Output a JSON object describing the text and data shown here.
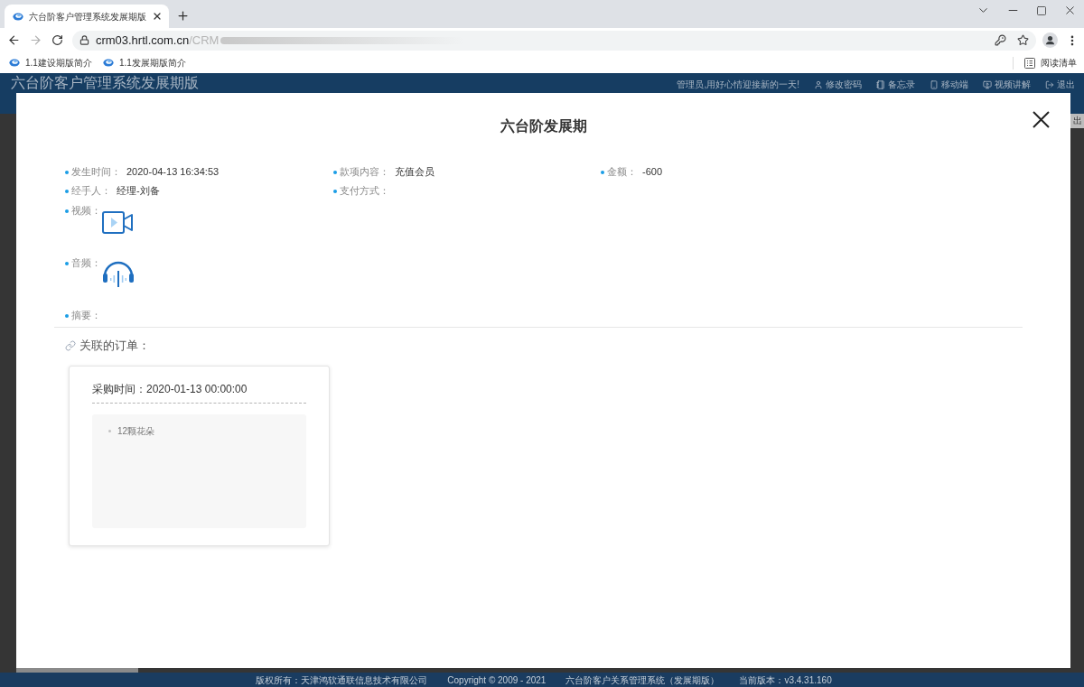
{
  "browser": {
    "tabs": [
      {
        "title": "六台阶客户管理系统发展期版",
        "selected": true
      }
    ],
    "forward_enabled": false,
    "address": {
      "host": "crm03.hrtl.com.cn",
      "path": "/CRM"
    },
    "bookmarks": [
      "1.1建设期版简介",
      "1.1发展期版简介"
    ],
    "reading_list": "阅读清单"
  },
  "app_header": {
    "title": "六台阶客户管理系统发展期版",
    "greeting": "管理员,用好心情迎接新的一天!",
    "nav": [
      "修改密码",
      "备忘录",
      "移动端",
      "视频讲解",
      "退出"
    ]
  },
  "page_behind": {
    "button_fragment": "出"
  },
  "modal": {
    "title": "六台阶发展期",
    "fields": [
      {
        "label": "发生时间：",
        "value": "2020-04-13 16:34:53"
      },
      {
        "label": "款项内容：",
        "value": "充值会员"
      },
      {
        "label": "金额：",
        "value": "-600"
      },
      {
        "label": "经手人：",
        "value": "经理-刘备"
      },
      {
        "label": "支付方式："
      }
    ],
    "rows": [
      {
        "kind": "video",
        "label": "视频："
      },
      {
        "kind": "audio",
        "label": "音频："
      },
      {
        "kind": "text",
        "label": "摘要："
      }
    ],
    "related": {
      "title": "关联的订单：",
      "orders": [
        {
          "time": "采购时间：2020-01-13 00:00:00",
          "items": [
            "12颗花朵"
          ]
        }
      ]
    }
  },
  "footer": [
    "版权所有：天津鸿软通联信息技术有限公司",
    "Copyright © 2009 - 2021",
    "六台阶客户关系管理系统（发展期版）",
    "当前版本：v3.4.31.160"
  ]
}
